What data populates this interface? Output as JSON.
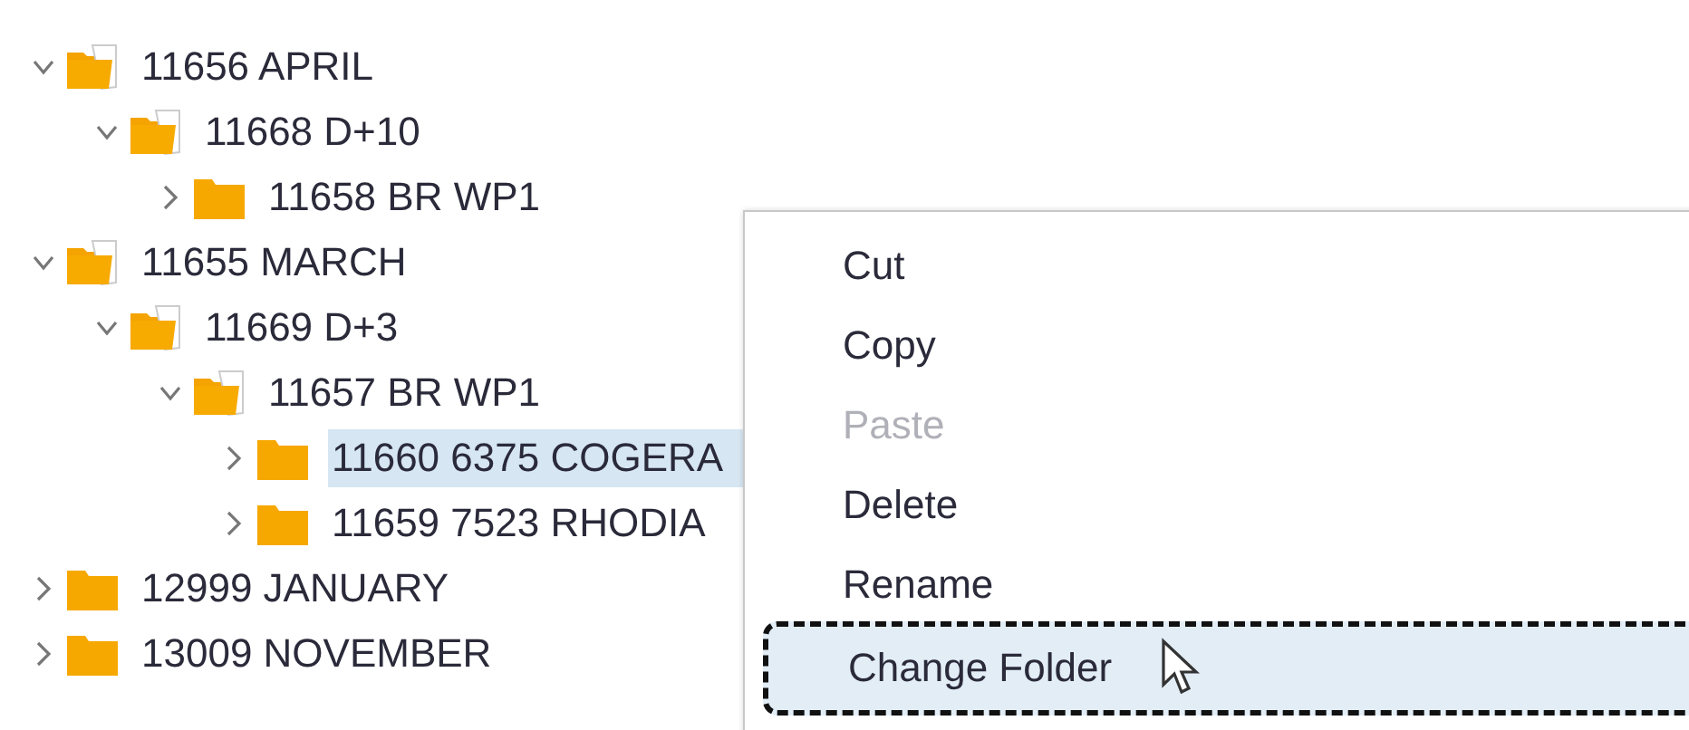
{
  "tree": {
    "items": [
      {
        "label": "11656 APRIL",
        "expanded": true,
        "selected": false,
        "children": [
          {
            "label": "11668 D+10",
            "expanded": true,
            "selected": false,
            "children": [
              {
                "label": "11658 BR WP1",
                "expanded": false,
                "selected": false
              }
            ]
          }
        ]
      },
      {
        "label": "11655 MARCH",
        "expanded": true,
        "selected": false,
        "children": [
          {
            "label": "11669 D+3",
            "expanded": true,
            "selected": false,
            "children": [
              {
                "label": "11657 BR WP1",
                "expanded": true,
                "selected": false,
                "children": [
                  {
                    "label": "11660 6375 COGERA",
                    "expanded": false,
                    "selected": true
                  },
                  {
                    "label": "11659 7523 RHODIA",
                    "expanded": false,
                    "selected": false
                  }
                ]
              }
            ]
          }
        ]
      },
      {
        "label": "12999 JANUARY",
        "expanded": false,
        "selected": false
      },
      {
        "label": "13009 NOVEMBER",
        "expanded": false,
        "selected": false
      }
    ]
  },
  "context_menu": {
    "items": [
      {
        "label": "Cut",
        "disabled": false,
        "selected": false
      },
      {
        "label": "Copy",
        "disabled": false,
        "selected": false
      },
      {
        "label": "Paste",
        "disabled": true,
        "selected": false
      },
      {
        "label": "Delete",
        "disabled": false,
        "selected": false
      },
      {
        "label": "Rename",
        "disabled": false,
        "selected": false
      },
      {
        "label": "Change Folder",
        "disabled": false,
        "selected": true
      }
    ]
  }
}
